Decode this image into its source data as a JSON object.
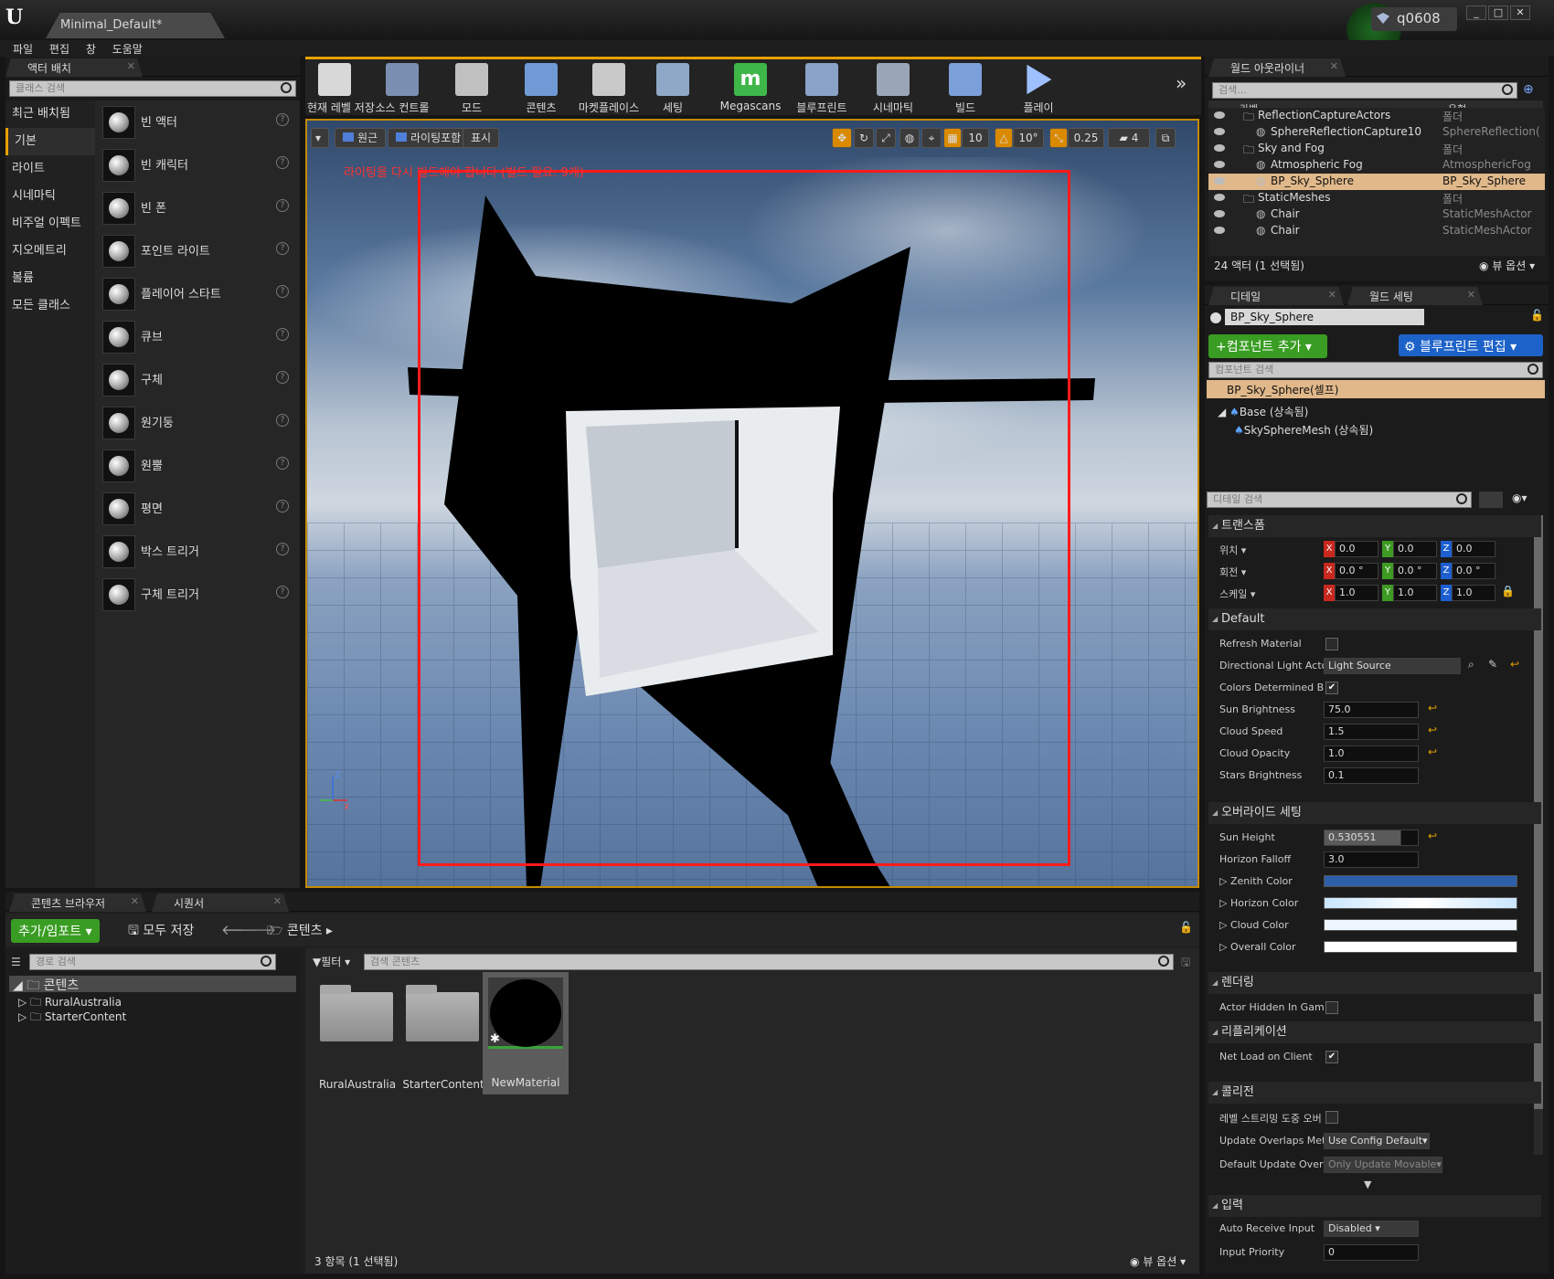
{
  "title_bar": {
    "doc_tab": "Minimal_Default*",
    "user": "q0608",
    "win_min": "_",
    "win_max": "□",
    "win_close": "✕"
  },
  "menu": [
    "파일",
    "편집",
    "창",
    "도움말"
  ],
  "place_actors": {
    "tab": "액터 배치",
    "search_placeholder": "클래스 검색",
    "categories": [
      "최근 배치됨",
      "기본",
      "라이트",
      "시네마틱",
      "비주얼 이펙트",
      "지오메트리",
      "볼륨",
      "모든 클래스"
    ],
    "selected_category": "기본",
    "items": [
      "빈 액터",
      "빈 캐릭터",
      "빈 폰",
      "포인트 라이트",
      "플레이어 스타트",
      "큐브",
      "구체",
      "원기둥",
      "원뿔",
      "평면",
      "박스 트리거",
      "구체 트리거"
    ]
  },
  "toolbar": {
    "buttons": [
      {
        "label": "현재 레벨 저장",
        "icon": "save-icon"
      },
      {
        "label": "소스 컨트롤",
        "icon": "source-control-icon"
      },
      {
        "label": "모드",
        "icon": "modes-icon"
      },
      {
        "label": "콘텐츠",
        "icon": "content-icon"
      },
      {
        "label": "마켓플레이스",
        "icon": "marketplace-icon"
      },
      {
        "label": "세팅",
        "icon": "settings-icon"
      },
      {
        "label": "Megascans",
        "icon": "megascans-icon"
      },
      {
        "label": "블루프린트",
        "icon": "blueprint-icon"
      },
      {
        "label": "시네마틱",
        "icon": "cinematic-icon"
      },
      {
        "label": "빌드",
        "icon": "build-icon"
      },
      {
        "label": "플레이",
        "icon": "play-icon"
      }
    ],
    "more": "»"
  },
  "viewport": {
    "perspective": "원근",
    "lighting": "라이팅포함",
    "show": "표시",
    "warning": "라이팅을 다시 빌드해야 합니다 (빌드 필요: 9개)",
    "grid_snap": "10",
    "rotation_snap": "10°",
    "scale_snap": "0.25",
    "camera_speed": "4"
  },
  "content_browser": {
    "tab": "콘텐츠 브라우저",
    "tab2": "시퀀서",
    "add_import": "추가/임포트",
    "save_all": "모두 저장",
    "path": "콘텐츠",
    "path_search": "경로 검색",
    "filter": "필터",
    "content_search": "검색 콘텐츠",
    "tree": {
      "root": "콘텐츠",
      "children": [
        "RuralAustralia",
        "StarterContent"
      ]
    },
    "assets": [
      "RuralAustralia",
      "StarterContent",
      "NewMaterial"
    ],
    "status": "3 항목 (1 선택됨)",
    "view_options": "뷰 옵션"
  },
  "outliner": {
    "tab": "월드 아웃라이너",
    "search_placeholder": "검색...",
    "col_label": "라벨",
    "col_type": "유형",
    "rows": [
      {
        "name": "ReflectionCaptureActors",
        "type": "폴더",
        "indent": 1
      },
      {
        "name": "SphereReflectionCapture10",
        "type": "SphereReflection(",
        "indent": 2
      },
      {
        "name": "Sky and Fog",
        "type": "폴더",
        "indent": 1
      },
      {
        "name": "Atmospheric Fog",
        "type": "AtmosphericFog",
        "indent": 2
      },
      {
        "name": "BP_Sky_Sphere",
        "type": "BP_Sky_Sphere",
        "indent": 2
      },
      {
        "name": "StaticMeshes",
        "type": "폴더",
        "indent": 1
      },
      {
        "name": "Chair",
        "type": "StaticMeshActor",
        "indent": 2
      },
      {
        "name": "Chair",
        "type": "StaticMeshActor",
        "indent": 2
      }
    ],
    "selected_row": 4,
    "status": "24 액터 (1 선택됨)",
    "view_options": "뷰 옵션"
  },
  "details": {
    "tab": "디테일",
    "tab2": "월드 세팅",
    "actor_name": "BP_Sky_Sphere",
    "add_component": "컴포넌트 추가",
    "edit_blueprint": "블루프린트 편집",
    "component_search": "컴포넌트 검색",
    "components": [
      "BP_Sky_Sphere(셀프)",
      "Base (상속됨)",
      "SkySphereMesh (상속됨)"
    ],
    "detail_search": "디테일 검색",
    "transform": {
      "header": "트랜스폼",
      "location_label": "위치",
      "rotation_label": "회전",
      "scale_label": "스케일",
      "location": [
        "0.0",
        "0.0",
        "0.0"
      ],
      "rotation": [
        "0.0 °",
        "0.0 °",
        "0.0 °"
      ],
      "scale": [
        "1.0",
        "1.0",
        "1.0"
      ]
    },
    "default": {
      "header": "Default",
      "refresh_material": "Refresh Material",
      "directional_light_label": "Directional Light Acto",
      "directional_light_value": "Light Source",
      "colors_determined": "Colors Determined By",
      "sun_brightness_label": "Sun Brightness",
      "sun_brightness": "75.0",
      "cloud_speed_label": "Cloud Speed",
      "cloud_speed": "1.5",
      "cloud_opacity_label": "Cloud Opacity",
      "cloud_opacity": "1.0",
      "stars_brightness_label": "Stars Brightness",
      "stars_brightness": "0.1"
    },
    "override": {
      "header": "오버라이드 세팅",
      "sun_height_label": "Sun Height",
      "sun_height": "0.530551",
      "horizon_falloff_label": "Horizon Falloff",
      "horizon_falloff": "3.0",
      "zenith_color_label": "Zenith Color",
      "zenith_color": "#2d5ea8",
      "horizon_color_label": "Horizon Color",
      "horizon_color": "#c9e6ff",
      "cloud_color_label": "Cloud Color",
      "cloud_color": "#eef6ff",
      "overall_color_label": "Overall Color",
      "overall_color": "#ffffff"
    },
    "rendering": {
      "header": "렌더링",
      "actor_hidden": "Actor Hidden In Game"
    },
    "replication": {
      "header": "리플리케이션",
      "net_load": "Net Load on Client"
    },
    "collision": {
      "header": "콜리전",
      "level_streaming": "레벨 스트리밍 도중 오버",
      "update_overlaps_label": "Update Overlaps Meth",
      "update_overlaps": "Use Config Default",
      "default_update_label": "Default Update Overla",
      "default_update": "Only Update Movable"
    },
    "input": {
      "header": "입력",
      "auto_receive_label": "Auto Receive Input",
      "auto_receive": "Disabled",
      "input_priority_label": "Input Priority",
      "input_priority": "0"
    }
  }
}
